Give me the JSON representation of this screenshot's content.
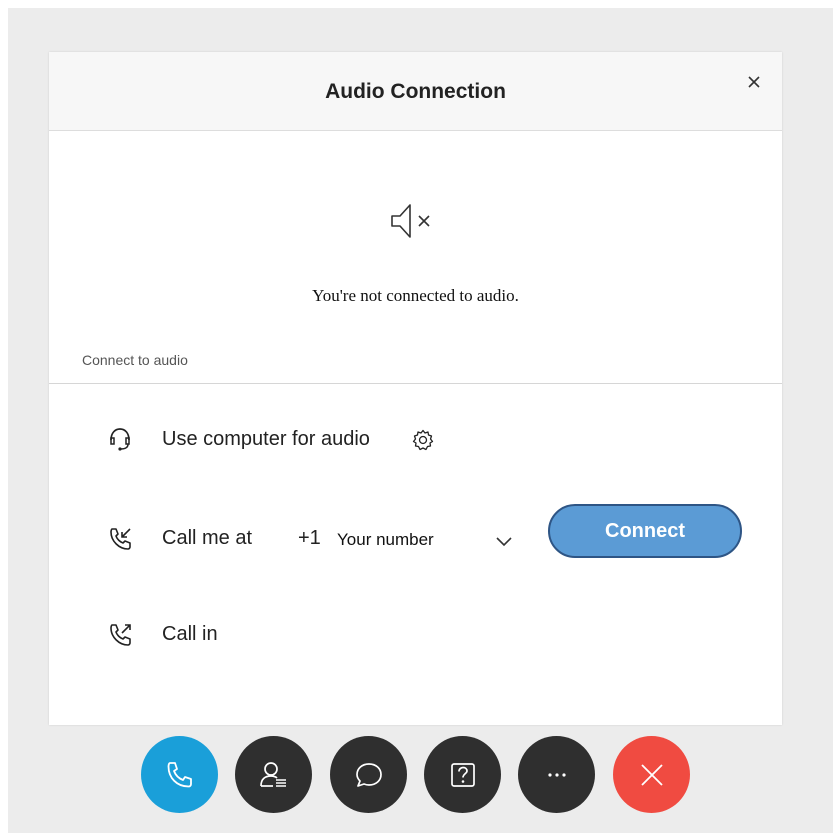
{
  "dialog": {
    "title": "Audio Connection",
    "status_text": "You're not connected to audio.",
    "section_label": "Connect to audio"
  },
  "options": {
    "computer_label": "Use computer for audio",
    "call_me_label": "Call me at",
    "country_code": "+1",
    "number_placeholder": "Your number",
    "call_in_label": "Call in"
  },
  "connect_button": {
    "label": "Connect"
  },
  "toolbar": {
    "buttons": [
      {
        "name": "audio",
        "color": "#1a9fd9"
      },
      {
        "name": "participants",
        "color": "#2f2f2f"
      },
      {
        "name": "chat",
        "color": "#2f2f2f"
      },
      {
        "name": "help",
        "color": "#2f2f2f"
      },
      {
        "name": "more",
        "color": "#2f2f2f"
      },
      {
        "name": "leave",
        "color": "#f04b41"
      }
    ]
  },
  "colors": {
    "accent": "#5b9bd5",
    "audio_button": "#1a9fd9",
    "leave_button": "#f04b41",
    "dark_button": "#2f2f2f"
  }
}
